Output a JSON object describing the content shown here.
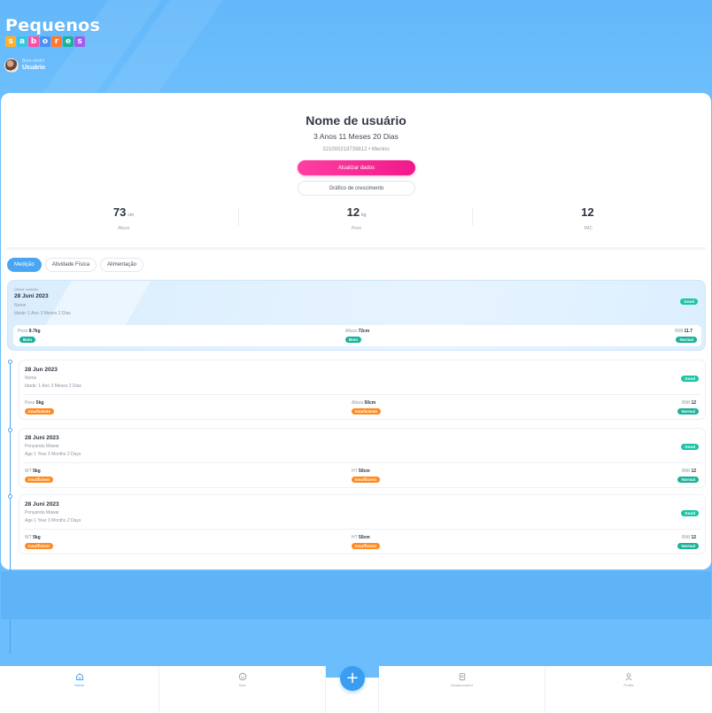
{
  "brand": {
    "word": "Pequenos",
    "letters": [
      "s",
      "a",
      "b",
      "o",
      "r",
      "e",
      "s"
    ],
    "letter_colors": [
      "#ffb02e",
      "#37c6e0",
      "#ff4fa3",
      "#4d8ff5",
      "#ff7a2e",
      "#1ab29b",
      "#a45cf0"
    ]
  },
  "welcome": {
    "greeting": "Bem-vindo!",
    "name": "Usuário"
  },
  "profile": {
    "name": "Nome de usuário",
    "age": "3 Anos 11 Meses 20 Dias",
    "id": "321000218739812",
    "separator": "•",
    "gender": "Menino",
    "update_button": "Atualizar dados",
    "growth_button": "Gráfico de crescimento"
  },
  "stats": [
    {
      "value": "73",
      "unit": "cm",
      "label": "Altura"
    },
    {
      "value": "12",
      "unit": "kg",
      "label": "Peso"
    },
    {
      "value": "12",
      "unit": "",
      "label": "IMC"
    }
  ],
  "tabs": [
    {
      "label": "Medição",
      "active": true
    },
    {
      "label": "Atividade Física",
      "active": false
    },
    {
      "label": "Alimentação",
      "active": false
    }
  ],
  "latest": {
    "tag": "Última medição",
    "date": "28 Juni 2023",
    "name": "Nome",
    "age": "Idade: 1 Ano 3 Meses 2 Dias",
    "status": "Good",
    "weight_label": "Peso",
    "weight_value": "8.7kg",
    "weight_status": "Bom",
    "height_label": "Altura",
    "height_value": "72cm",
    "height_status": "Bom",
    "bmi_label": "BMI",
    "bmi_value": "11.7",
    "bmi_status": "Normal"
  },
  "records": [
    {
      "date": "28 Jun 2023",
      "name": "Nome",
      "age": "Idade: 1 Ano 3 Meses 2 Dias",
      "status": "Good",
      "weight_label": "Peso",
      "weight_value": "5kg",
      "weight_status": "Insuficiente",
      "height_label": "Altura",
      "height_value": "50cm",
      "height_status": "Insuficiente",
      "bmi_label": "BMI",
      "bmi_value": "12",
      "bmi_status": "Normal"
    },
    {
      "date": "28 Juni 2023",
      "name": "Ponyandu Mawar",
      "age": "Age 1 Year 3 Months 2 Days",
      "status": "Good",
      "weight_label": "WT",
      "weight_value": "5kg",
      "weight_status": "Insufficient",
      "height_label": "HT",
      "height_value": "50cm",
      "height_status": "Insufficient",
      "bmi_label": "BMI",
      "bmi_value": "12",
      "bmi_status": "Normal"
    },
    {
      "date": "28 Juni 2023",
      "name": "Ponyandu Mawar",
      "age": "Age 1 Year 3 Months 2 Days",
      "status": "Good",
      "weight_label": "WT",
      "weight_value": "5kg",
      "weight_status": "Insufficient",
      "height_label": "HT",
      "height_value": "50cm",
      "height_status": "Insufficient",
      "bmi_label": "BMI",
      "bmi_value": "12",
      "bmi_status": "Normal"
    }
  ],
  "nav": {
    "items": [
      {
        "label": "Home",
        "icon": "home-icon",
        "active": true
      },
      {
        "label": "Kids",
        "icon": "smile-icon",
        "active": false
      },
      {
        "label": "Measurement",
        "icon": "clipboard-icon",
        "active": false
      },
      {
        "label": "Profile",
        "icon": "user-icon",
        "active": false
      }
    ],
    "fab": "+"
  },
  "colors": {
    "accent": "#4aa6f2",
    "pink": "#f0198a",
    "good": "#1ac5a6",
    "insufficient": "#ff8a1f"
  }
}
